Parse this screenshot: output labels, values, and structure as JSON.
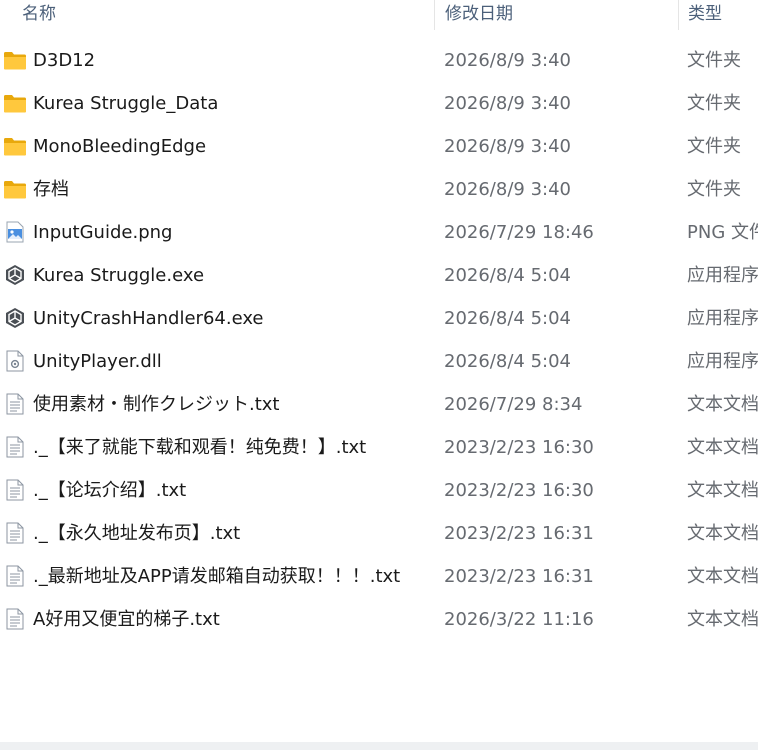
{
  "columns": {
    "name": "名称",
    "modified": "修改日期",
    "type": "类型"
  },
  "files": [
    {
      "name": "D3D12",
      "modified": "2026/8/9 3:40",
      "type": "文件夹",
      "icon": "folder-icon"
    },
    {
      "name": "Kurea Struggle_Data",
      "modified": "2026/8/9 3:40",
      "type": "文件夹",
      "icon": "folder-icon"
    },
    {
      "name": "MonoBleedingEdge",
      "modified": "2026/8/9 3:40",
      "type": "文件夹",
      "icon": "folder-icon"
    },
    {
      "name": "存档",
      "modified": "2026/8/9 3:40",
      "type": "文件夹",
      "icon": "folder-icon"
    },
    {
      "name": "InputGuide.png",
      "modified": "2026/7/29 18:46",
      "type": "PNG 文件",
      "icon": "image-file-icon"
    },
    {
      "name": "Kurea Struggle.exe",
      "modified": "2026/8/4 5:04",
      "type": "应用程序",
      "icon": "unity-app-icon"
    },
    {
      "name": "UnityCrashHandler64.exe",
      "modified": "2026/8/4 5:04",
      "type": "应用程序",
      "icon": "unity-app-icon"
    },
    {
      "name": "UnityPlayer.dll",
      "modified": "2026/8/4 5:04",
      "type": "应用程序",
      "icon": "dll-file-icon"
    },
    {
      "name": "使用素材・制作クレジット.txt",
      "modified": "2026/7/29 8:34",
      "type": "文本文档",
      "icon": "text-file-icon"
    },
    {
      "name": "._【来了就能下载和观看！纯免费！】.txt",
      "modified": "2023/2/23 16:30",
      "type": "文本文档",
      "icon": "text-file-icon"
    },
    {
      "name": "._【论坛介绍】.txt",
      "modified": "2023/2/23 16:30",
      "type": "文本文档",
      "icon": "text-file-icon"
    },
    {
      "name": "._【永久地址发布页】.txt",
      "modified": "2023/2/23 16:31",
      "type": "文本文档",
      "icon": "text-file-icon"
    },
    {
      "name": "._最新地址及APP请发邮箱自动获取！！！.txt",
      "modified": "2023/2/23 16:31",
      "type": "文本文档",
      "icon": "text-file-icon"
    },
    {
      "name": "A好用又便宜的梯子.txt",
      "modified": "2026/3/22 11:16",
      "type": "文本文档",
      "icon": "text-file-icon"
    }
  ]
}
